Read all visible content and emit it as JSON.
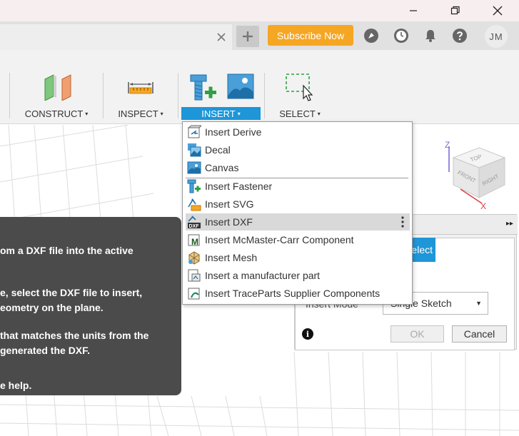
{
  "titlebar": {
    "minimize": "minimize",
    "restore": "restore",
    "close": "close"
  },
  "header": {
    "subscribe_label": "Subscribe Now",
    "avatar_initials": "JM"
  },
  "toolbar": {
    "groups": [
      {
        "label": "CONSTRUCT"
      },
      {
        "label": "INSPECT"
      },
      {
        "label": "INSERT"
      },
      {
        "label": "SELECT"
      }
    ],
    "caret": "▾"
  },
  "insert_menu": {
    "items": [
      {
        "label": "Insert Derive",
        "icon": "derive-icon"
      },
      {
        "label": "Decal",
        "icon": "decal-icon"
      },
      {
        "label": "Canvas",
        "icon": "canvas-icon"
      },
      {
        "label": "Insert Fastener",
        "icon": "fastener-icon"
      },
      {
        "label": "Insert SVG",
        "icon": "svg-icon"
      },
      {
        "label": "Insert DXF",
        "icon": "dxf-icon",
        "icon_text": "DXF"
      },
      {
        "label": "Insert McMaster-Carr Component",
        "icon": "mcmaster-icon",
        "icon_text": "M"
      },
      {
        "label": "Insert Mesh",
        "icon": "mesh-icon"
      },
      {
        "label": "Insert a manufacturer part",
        "icon": "manufacturer-part-icon"
      },
      {
        "label": "Insert TraceParts Supplier Components",
        "icon": "traceparts-icon"
      }
    ],
    "hovered_index": 5
  },
  "tooltip": {
    "lines": [
      "om a DXF file into the active",
      "e, select the DXF file to insert,",
      "eometry on the plane.",
      "that matches the units from the",
      "generated the DXF.",
      "e help."
    ]
  },
  "dialog": {
    "expand_glyph": "▸▸",
    "select_label": "elect",
    "mode_label": "Insert Mode",
    "mode_value": "Single Sketch",
    "mode_arrow": "▼",
    "info_glyph": "i",
    "ok_label": "OK",
    "cancel_label": "Cancel"
  },
  "viewcube": {
    "top": "TOP",
    "front": "FRONT",
    "right": "RIGHT",
    "z_axis": "Z",
    "x_axis": "X"
  },
  "colors": {
    "accent": "#1e96d8",
    "subscribe": "#f5a623",
    "tooltip_bg": "#4b4b4b"
  }
}
